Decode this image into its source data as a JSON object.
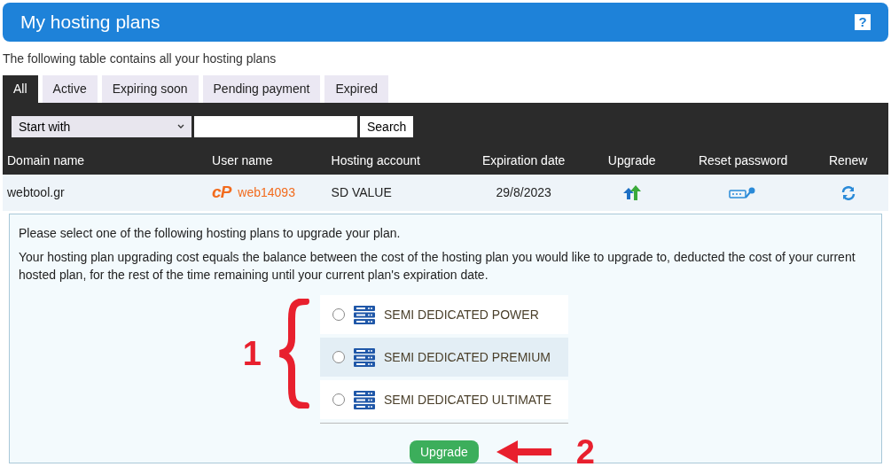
{
  "header": {
    "title": "My hosting plans",
    "help": "?"
  },
  "subtitle": "The following table contains all your hosting plans",
  "tabs": [
    {
      "label": "All",
      "selected": true
    },
    {
      "label": "Active",
      "selected": false
    },
    {
      "label": "Expiring soon",
      "selected": false
    },
    {
      "label": "Pending payment",
      "selected": false
    },
    {
      "label": "Expired",
      "selected": false
    }
  ],
  "filter": {
    "mode": "Start with",
    "search_button": "Search"
  },
  "table": {
    "columns": [
      "Domain name",
      "User name",
      "Hosting account",
      "Expiration date",
      "Upgrade",
      "Reset password",
      "Renew"
    ],
    "rows": [
      {
        "domain": "webtool.gr",
        "cpanel_logo": "cP",
        "user": "web14093",
        "account": "SD VALUE",
        "expires": "29/8/2023",
        "expanded": true
      }
    ]
  },
  "upgrade_panel": {
    "intro": "Please select one of the following hosting plans to upgrade your plan.",
    "explanation": "Your hosting plan upgrading cost equals the balance between the cost of the hosting plan you would like to upgrade to, deducted the cost of your current hosted plan, for the rest of the time remaining until your current plan's expiration date.",
    "plans": [
      {
        "name": "SEMI DEDICATED POWER",
        "checked": false,
        "highlighted": false
      },
      {
        "name": "SEMI DEDICATED PREMIUM",
        "checked": false,
        "highlighted": true
      },
      {
        "name": "SEMI DEDICATED ULTIMATE",
        "checked": false,
        "highlighted": false
      }
    ],
    "button": "Upgrade"
  },
  "annotations": [
    {
      "kind": "brace",
      "label": "1"
    },
    {
      "kind": "arrow",
      "label": "2"
    }
  ]
}
